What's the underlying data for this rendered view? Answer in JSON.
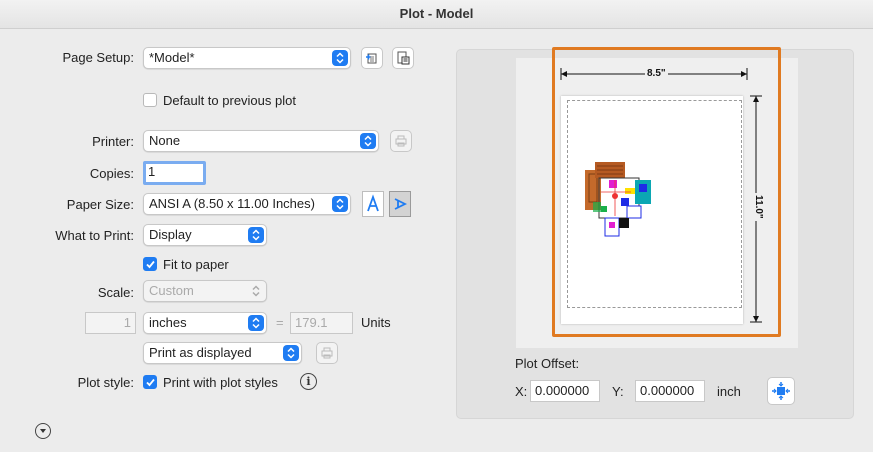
{
  "window": {
    "title": "Plot - Model"
  },
  "page_setup": {
    "label": "Page Setup:",
    "value": "*Model*"
  },
  "default_previous": {
    "label": "Default to previous plot",
    "checked": false
  },
  "printer": {
    "label": "Printer:",
    "value": "None"
  },
  "copies": {
    "label": "Copies:",
    "value": "1"
  },
  "paper_size": {
    "label": "Paper Size:",
    "value": "ANSI A (8.50 x 11.00 Inches)"
  },
  "what_to_print": {
    "label": "What to Print:",
    "value": "Display"
  },
  "fit_to_paper": {
    "label": "Fit to paper",
    "checked": true
  },
  "scale": {
    "label": "Scale:",
    "value": "Custom",
    "numerator": "1",
    "units_value": "inches",
    "equals": "=",
    "denominator": "179.1",
    "units_label": "Units"
  },
  "print_mode": {
    "value": "Print as displayed"
  },
  "plot_style": {
    "label": "Plot style:",
    "checkbox_label": "Print with plot styles",
    "checked": true
  },
  "preview": {
    "width_dim": "8.5\"",
    "height_dim": "11.0\""
  },
  "plot_offset": {
    "title": "Plot Offset:",
    "x_label": "X:",
    "x_value": "0.000000",
    "y_label": "Y:",
    "y_value": "0.000000",
    "unit": "inch"
  },
  "colors": {
    "accent": "#1f7cf2",
    "highlight": "#e07a21"
  }
}
